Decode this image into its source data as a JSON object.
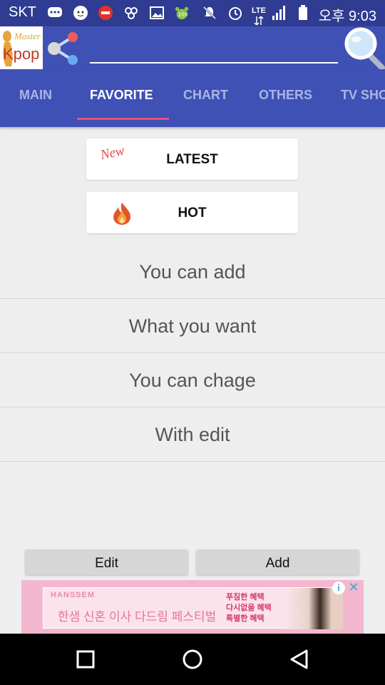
{
  "status_bar": {
    "carrier": "SKT",
    "network": "LTE",
    "time": "오후 9:03",
    "icons": [
      "chat-icon",
      "face-app-icon",
      "cgv-app-icon",
      "link-app-icon",
      "gallery-icon",
      "paw-app-icon",
      "mute-icon",
      "alarm-icon",
      "data-transfer-icon",
      "signal-icon",
      "battery-icon"
    ]
  },
  "app_bar": {
    "logo": {
      "small": "Master",
      "main": "Kpop"
    },
    "search": {
      "value": "",
      "placeholder": ""
    },
    "icons": [
      "share-icon",
      "search-icon"
    ]
  },
  "tabs": [
    {
      "label": "MAIN",
      "active": false
    },
    {
      "label": "FAVORITE",
      "active": true
    },
    {
      "label": "CHART",
      "active": false
    },
    {
      "label": "OTHERS",
      "active": false
    },
    {
      "label": "TV SHOW",
      "active": false
    }
  ],
  "cards": [
    {
      "label": "LATEST",
      "badge": "New"
    },
    {
      "label": "HOT",
      "icon": "flame-icon"
    }
  ],
  "list": [
    "You can add",
    "What you want",
    "You can chage",
    "With edit"
  ],
  "buttons": {
    "edit": "Edit",
    "add": "Add"
  },
  "ad": {
    "brand": "HANSSEM",
    "headline": "한샘 신혼 이사 다드림 페스티벌",
    "side_lines": [
      "푸짐한 혜택",
      "다시없을 혜택",
      "특별한 혜택"
    ],
    "info": "i",
    "close": "✕"
  },
  "colors": {
    "status_bar": "#2f3c91",
    "app_bar": "#3f51b5",
    "tab_indicator": "#e8507a",
    "background": "#eeeeee"
  }
}
